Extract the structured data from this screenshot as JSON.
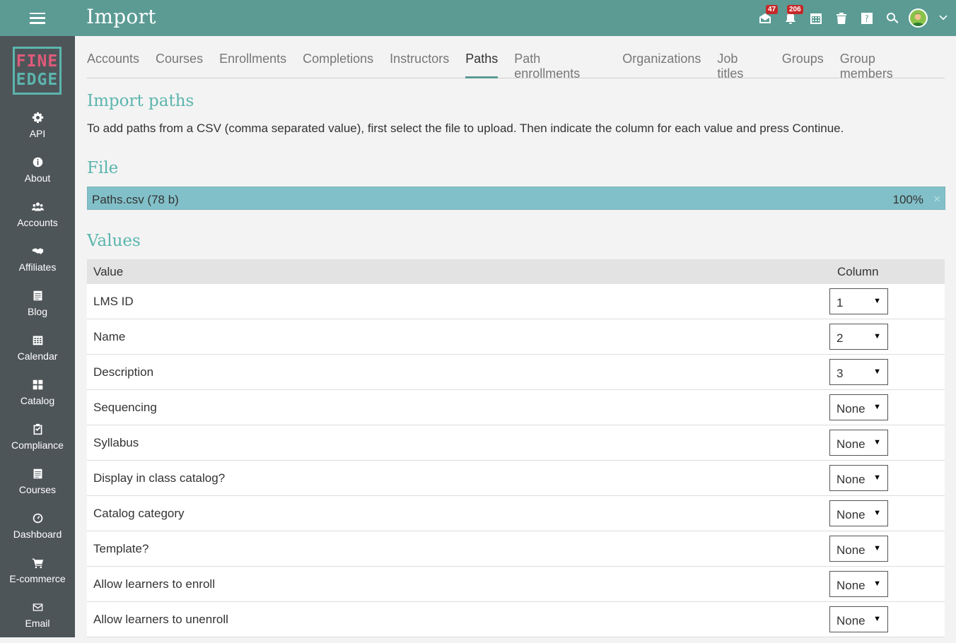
{
  "header": {
    "title": "Import",
    "messages_badge": "47",
    "notifications_badge": "206"
  },
  "logo": {
    "line1": "FINE",
    "line2": "EDGE"
  },
  "sidebar": {
    "items": [
      {
        "label": "API",
        "icon": "gear-icon"
      },
      {
        "label": "About",
        "icon": "info-icon"
      },
      {
        "label": "Accounts",
        "icon": "users-icon"
      },
      {
        "label": "Affiliates",
        "icon": "handshake-icon"
      },
      {
        "label": "Blog",
        "icon": "blog-icon"
      },
      {
        "label": "Calendar",
        "icon": "calendar-icon"
      },
      {
        "label": "Catalog",
        "icon": "grid-icon"
      },
      {
        "label": "Compliance",
        "icon": "clipboard-check-icon"
      },
      {
        "label": "Courses",
        "icon": "courses-icon"
      },
      {
        "label": "Dashboard",
        "icon": "dashboard-icon"
      },
      {
        "label": "E-commerce",
        "icon": "cart-icon"
      },
      {
        "label": "Email",
        "icon": "envelope-icon"
      }
    ]
  },
  "tabs": [
    {
      "label": "Accounts"
    },
    {
      "label": "Courses"
    },
    {
      "label": "Enrollments"
    },
    {
      "label": "Completions"
    },
    {
      "label": "Instructors"
    },
    {
      "label": "Paths",
      "active": true
    },
    {
      "label": "Path enrollments"
    },
    {
      "label": "Organizations"
    },
    {
      "label": "Job titles"
    },
    {
      "label": "Groups"
    },
    {
      "label": "Group members"
    }
  ],
  "main": {
    "heading": "Import paths",
    "description": "To add paths from a CSV (comma separated value), first select the file to upload. Then indicate the column for each value and press Continue.",
    "file_heading": "File",
    "file": {
      "name": "Paths.csv (78 b)",
      "progress": "100%",
      "progress_value": 1.0,
      "remove_glyph": "×"
    },
    "values_heading": "Values",
    "table": {
      "headers": {
        "value": "Value",
        "column": "Column"
      },
      "rows": [
        {
          "value": "LMS ID",
          "column": "1"
        },
        {
          "value": "Name",
          "column": "2"
        },
        {
          "value": "Description",
          "column": "3"
        },
        {
          "value": "Sequencing",
          "column": "None"
        },
        {
          "value": "Syllabus",
          "column": "None"
        },
        {
          "value": "Display in class catalog?",
          "column": "None"
        },
        {
          "value": "Catalog category",
          "column": "None"
        },
        {
          "value": "Template?",
          "column": "None"
        },
        {
          "value": "Allow learners to enroll",
          "column": "None"
        },
        {
          "value": "Allow learners to unenroll",
          "column": "None"
        }
      ]
    }
  },
  "colors": {
    "topbar": "#5b9b94",
    "sidebar": "#4e5559",
    "accent": "#5bb5ad",
    "filebar": "#82c0c9",
    "badge": "#c62828"
  }
}
